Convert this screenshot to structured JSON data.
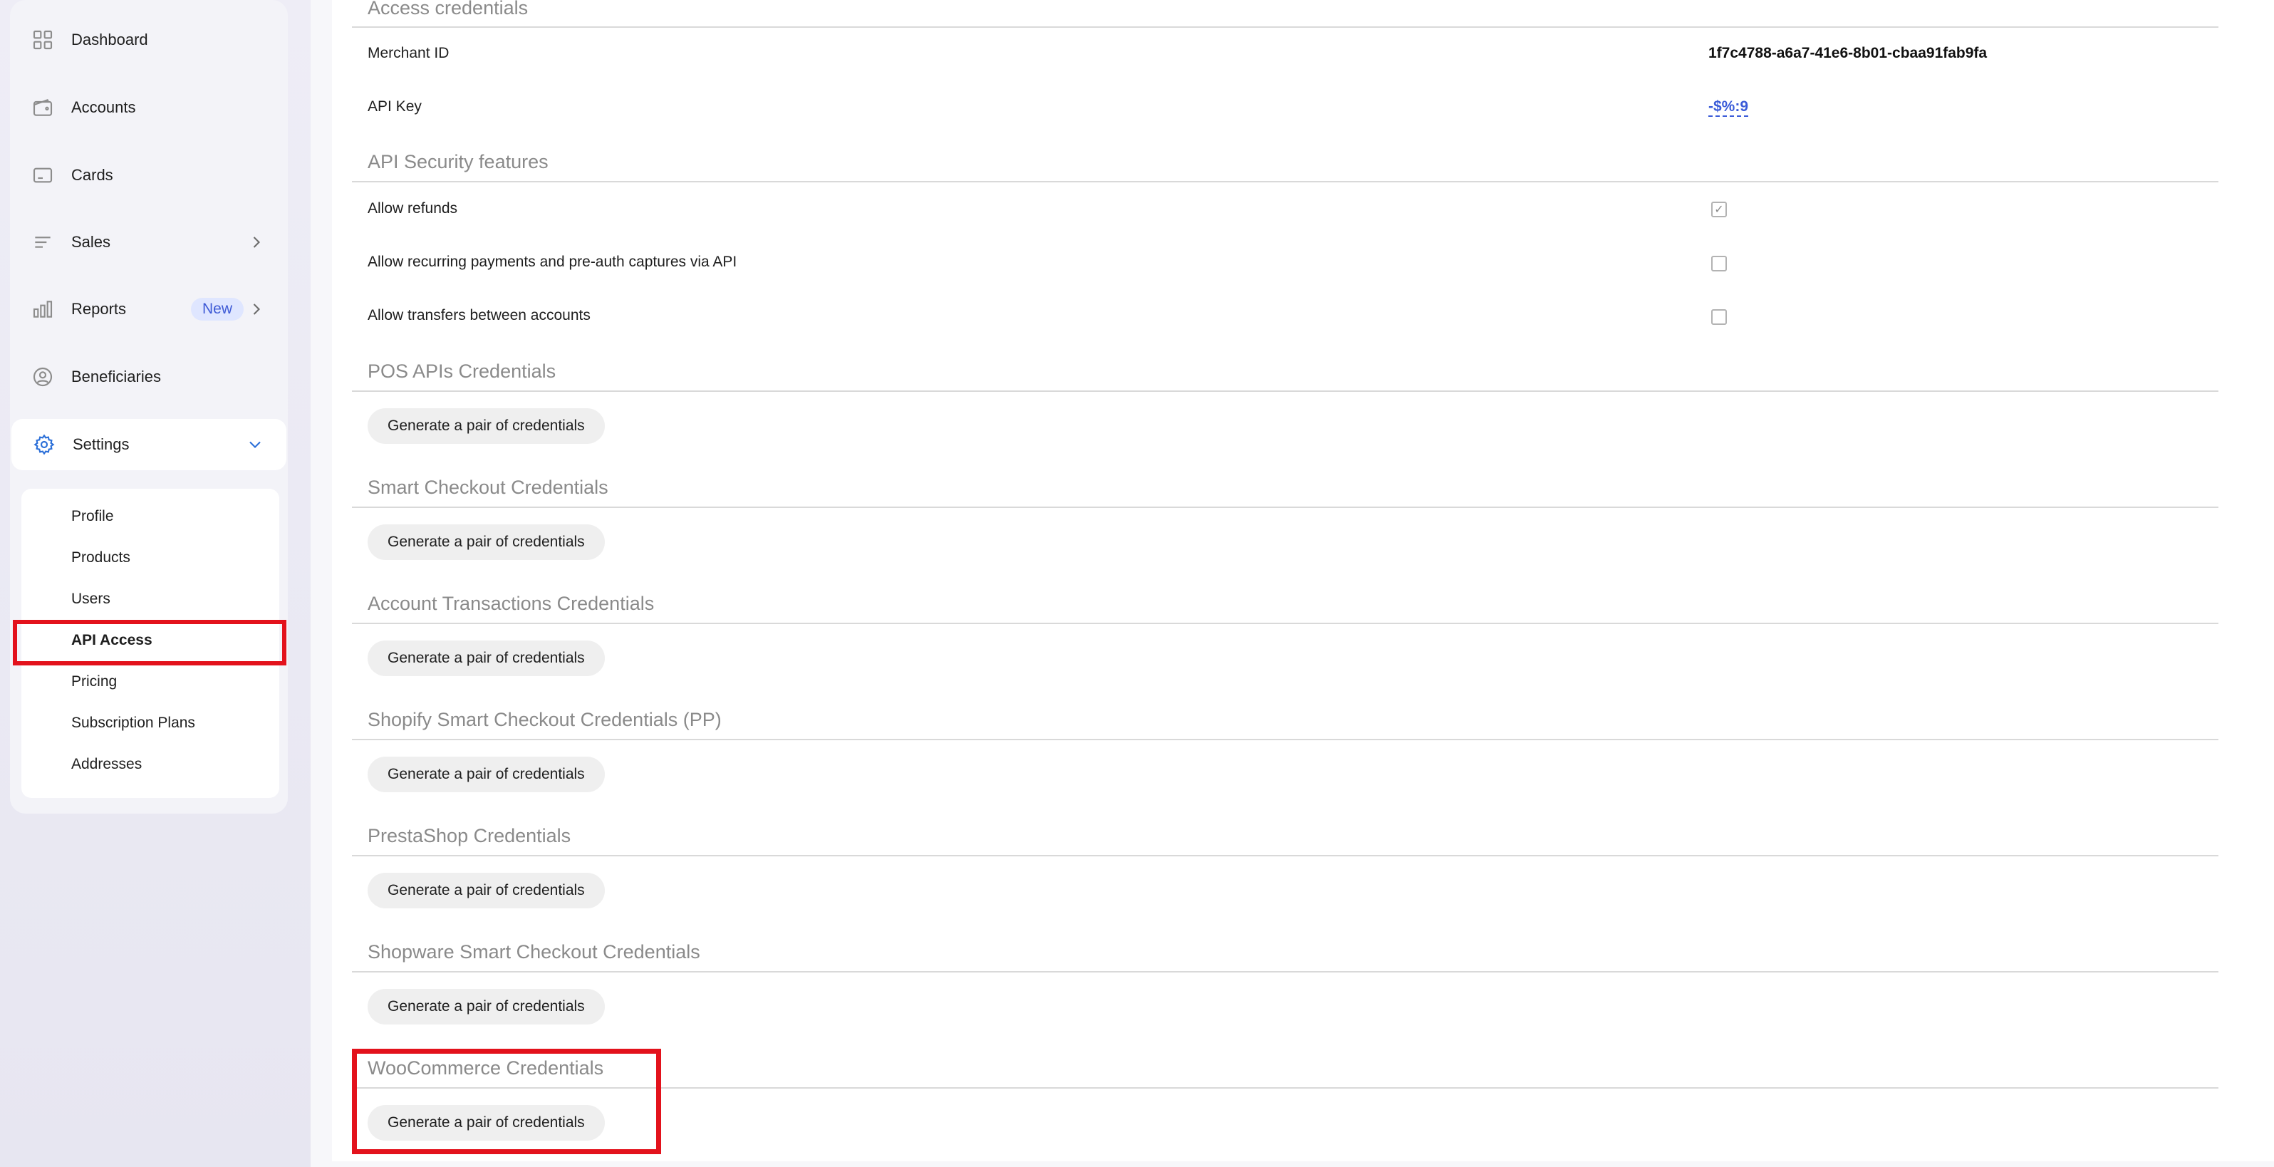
{
  "sidebar": {
    "items": [
      {
        "label": "Dashboard",
        "icon": "dashboard-grid-icon"
      },
      {
        "label": "Accounts",
        "icon": "wallet-icon"
      },
      {
        "label": "Cards",
        "icon": "card-icon"
      },
      {
        "label": "Sales",
        "icon": "list-lines-icon"
      },
      {
        "label": "Reports",
        "icon": "bar-chart-icon",
        "badge": "New"
      },
      {
        "label": "Beneficiaries",
        "icon": "user-circle-icon"
      },
      {
        "label": "Settings",
        "icon": "gear-icon"
      }
    ],
    "settings_sub": [
      "Profile",
      "Products",
      "Users",
      "API Access",
      "Pricing",
      "Subscription Plans",
      "Addresses"
    ],
    "active_sub": "API Access"
  },
  "main": {
    "access": {
      "title": "Access credentials",
      "merchant_label": "Merchant ID",
      "merchant_value": "1f7c4788-a6a7-41e6-8b01-cbaa91fab9fa",
      "api_key_label": "API Key",
      "api_key_value": "-$%:9"
    },
    "security": {
      "title": "API Security features",
      "features": [
        {
          "label": "Allow refunds",
          "checked": true
        },
        {
          "label": "Allow recurring payments and pre-auth captures via API",
          "checked": false
        },
        {
          "label": "Allow transfers between accounts",
          "checked": false
        }
      ]
    },
    "credential_sections": [
      {
        "title": "POS APIs Credentials",
        "button": "Generate a pair of credentials"
      },
      {
        "title": "Smart Checkout Credentials",
        "button": "Generate a pair of credentials"
      },
      {
        "title": "Account Transactions Credentials",
        "button": "Generate a pair of credentials"
      },
      {
        "title": "Shopify Smart Checkout Credentials (PP)",
        "button": "Generate a pair of credentials"
      },
      {
        "title": "PrestaShop Credentials",
        "button": "Generate a pair of credentials"
      },
      {
        "title": "Shopware Smart Checkout Credentials",
        "button": "Generate a pair of credentials"
      },
      {
        "title": "WooCommerce Credentials",
        "button": "Generate a pair of credentials"
      }
    ]
  },
  "colors": {
    "highlight": "#e3121c",
    "link": "#3a5bd8",
    "badge_bg": "#dfe6ff"
  }
}
